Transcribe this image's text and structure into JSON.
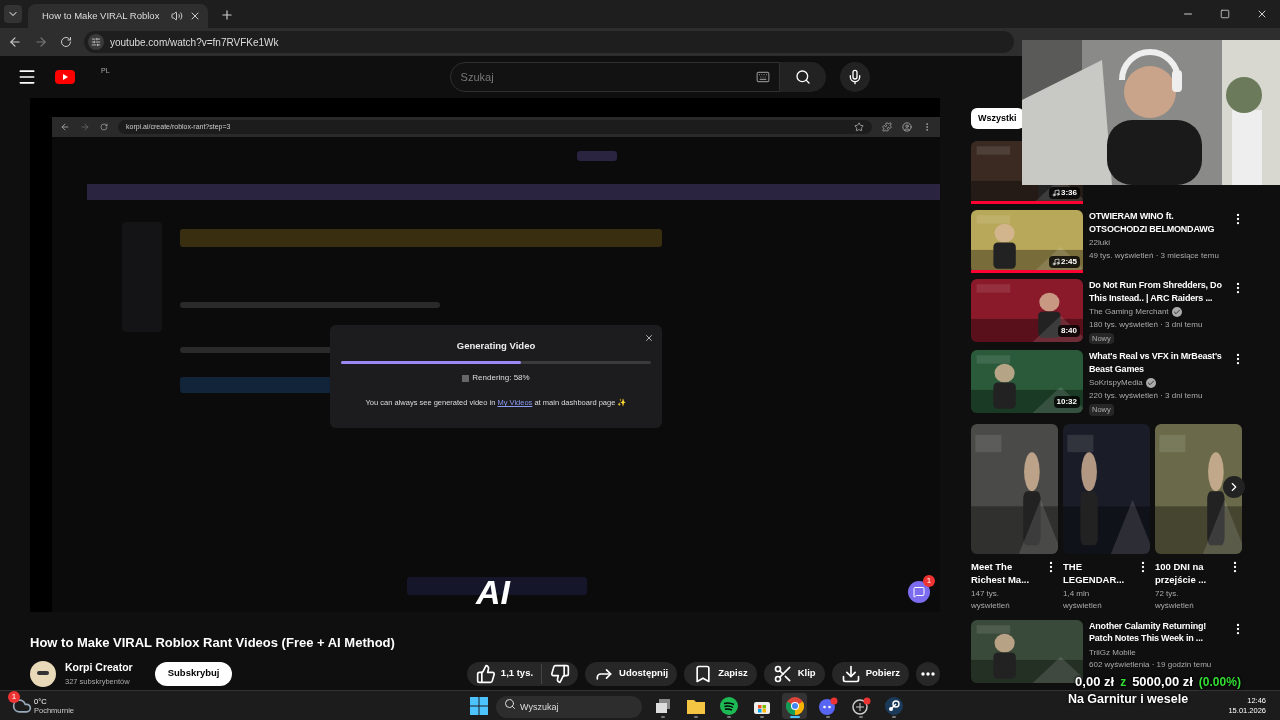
{
  "browser": {
    "tab_title": "How to Make VIRAL Roblox",
    "url": "youtube.com/watch?v=fn7RVFKe1Wk"
  },
  "youtube": {
    "region": "PL",
    "search_placeholder": "Szukaj"
  },
  "player": {
    "inner_url": "korpi.ai/create/roblox-rant?step=3",
    "modal": {
      "title": "Generating Video",
      "level": 0.58,
      "status": "Rendering: 58%",
      "note_before": "You can always see generated video in",
      "link": "My Videos",
      "note_after": "at main dashboard page ✨"
    },
    "caption": "AI",
    "chat_badge": "1"
  },
  "video": {
    "title": "How to Make VIRAL Roblox Rant Videos (Free + AI Method)",
    "channel": "Korpi Creator",
    "subscribers": "327 subskrybentów",
    "subscribe": "Subskrybuj",
    "actions": [
      {
        "kind": "like",
        "label": "1,1 tys."
      },
      {
        "kind": "dislike"
      },
      {
        "kind": "share",
        "label": "Udostępnij"
      },
      {
        "kind": "save",
        "label": "Zapisz"
      },
      {
        "kind": "clip",
        "label": "Klip"
      },
      {
        "kind": "download",
        "label": "Pobierz"
      },
      {
        "kind": "more"
      }
    ]
  },
  "sidebar": {
    "chip": "Wszystki",
    "items": [
      {
        "duration": "3:36",
        "music": true,
        "watched": true
      },
      {
        "title": "OTWIERAM WINO ft. OTSOCHODZI BELMONDAWG",
        "channel": "22luki",
        "verified": false,
        "meta": "49 tys. wyświetleń · 3 miesiące temu",
        "duration": "2:45",
        "music": true,
        "watched": true
      },
      {
        "title": "Do Not Run From Shredders, Do This Instead.. | ARC Raiders ...",
        "channel": "The Gaming Merchant",
        "verified": true,
        "meta": "180 tys. wyświetleń · 3 dni temu",
        "badge": "Nowy",
        "duration": "8:40",
        "music": false,
        "watched": false
      },
      {
        "title": "What's Real vs VFX in MrBeast's Beast Games",
        "channel": "SoKrispyMedia",
        "verified": true,
        "meta": "220 tys. wyświetleń · 3 dni temu",
        "badge": "Nowy",
        "duration": "10:32",
        "music": false,
        "watched": false
      }
    ],
    "shorts": [
      {
        "title": "Meet The Richest Ma...",
        "views": "147 tys. wyświetleń"
      },
      {
        "title": "THE LEGENDAR...",
        "views": "1,4 mln wyświetleń"
      },
      {
        "title": "100 DNI na przejście ...",
        "views": "72 tys. wyświetleń"
      }
    ],
    "last_item": {
      "title": "Another Calamity Returning! Patch Notes This Week in ...",
      "channel": "TriiGz Mobile",
      "meta": "602 wyświetlenia · 19 godzin temu"
    }
  },
  "donation": {
    "current": "0,00 zł",
    "separator": "z",
    "goal": "5000,00 zł",
    "percent": "(0.00%)",
    "label": "Na Garnitur i wesele"
  },
  "taskbar": {
    "weather_badge": "1",
    "temperature": "0°C",
    "condition": "Pochmurnie",
    "search_placeholder": "Wyszukaj",
    "apps": [
      {
        "kind": "taskview",
        "selected": false
      },
      {
        "kind": "explorer",
        "selected": false
      },
      {
        "kind": "spotify",
        "selected": false
      },
      {
        "kind": "store",
        "selected": false
      },
      {
        "kind": "chrome",
        "selected": true
      },
      {
        "kind": "discord",
        "selected": false
      },
      {
        "kind": "game",
        "selected": false
      },
      {
        "kind": "steam",
        "selected": false
      }
    ],
    "time": "12:46",
    "date": "15.01.2026"
  }
}
